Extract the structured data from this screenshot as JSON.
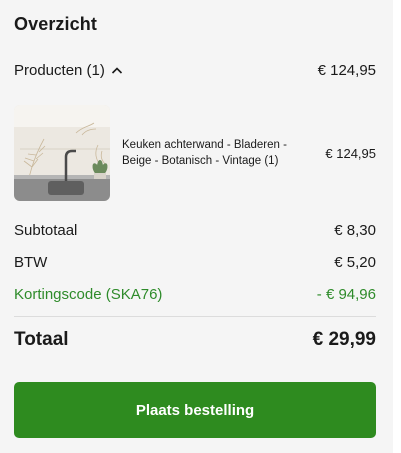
{
  "summary": {
    "title": "Overzicht",
    "products_label": "Producten (1)",
    "products_total": "€ 124,95"
  },
  "items": [
    {
      "name": "Keuken achterwand - Bladeren - Beige - Botanisch - Vintage (1)",
      "price": "€ 124,95"
    }
  ],
  "totals": {
    "subtotal_label": "Subtotaal",
    "subtotal_value": "€ 8,30",
    "vat_label": "BTW",
    "vat_value": "€ 5,20",
    "discount_label": "Kortingscode (SKA76)",
    "discount_value": "- € 94,96",
    "total_label": "Totaal",
    "total_value": "€ 29,99"
  },
  "checkout": {
    "button_label": "Plaats bestelling"
  },
  "colors": {
    "accent": "#2e8b1f",
    "discount_text": "#2e8b2a"
  },
  "icons": {
    "products_toggle": "chevron-up-icon"
  }
}
